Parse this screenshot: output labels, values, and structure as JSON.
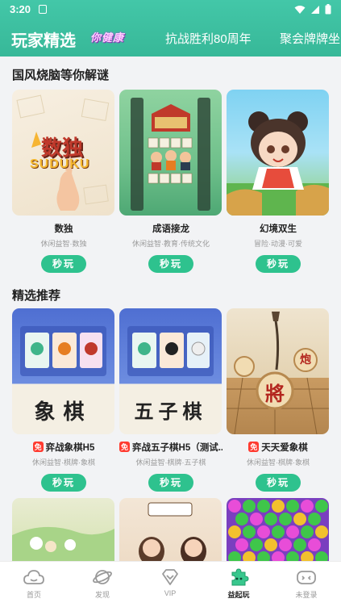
{
  "status": {
    "time": "3:20"
  },
  "header": {
    "title": "玩家精选",
    "badge": "你健康",
    "tabs": [
      {
        "label": "抗战胜利80周年"
      },
      {
        "label": "聚会牌牌坐"
      }
    ]
  },
  "sections": [
    {
      "title": "国风烧脑等你解谜",
      "games": [
        {
          "name": "数独",
          "free": false,
          "tags": "休闲益智·数独",
          "button": "秒玩",
          "art_text": "数独",
          "art_sub": "SUDUKU"
        },
        {
          "name": "成语接龙",
          "free": false,
          "tags": "休闲益智·教育·传统文化",
          "button": "秒玩"
        },
        {
          "name": "幻境双生",
          "free": false,
          "tags": "冒险·动漫·可爱",
          "button": "秒玩"
        }
      ]
    },
    {
      "title": "精选推荐",
      "games": [
        {
          "name": "弈战象棋H5",
          "free": true,
          "tags": "休闲益智·棋牌·象棋",
          "button": "秒玩",
          "art_text": "象棋"
        },
        {
          "name": "弈战五子棋H5（测试...",
          "free": true,
          "tags": "休闲益智·棋牌·五子棋",
          "button": "秒玩",
          "art_text": "五子棋"
        },
        {
          "name": "天天爱象棋",
          "free": true,
          "tags": "休闲益智·棋牌·象棋",
          "button": "秒玩",
          "art_text": "將",
          "art_sub": "炮"
        }
      ]
    }
  ],
  "free_label": "免",
  "tabbar": [
    {
      "label": "首页",
      "icon": "home-cloud-icon"
    },
    {
      "label": "发现",
      "icon": "planet-icon"
    },
    {
      "label": "VIP",
      "icon": "diamond-icon"
    },
    {
      "label": "益起玩",
      "icon": "puzzle-icon",
      "active": true
    },
    {
      "label": "未登录",
      "icon": "gamepad-icon"
    }
  ],
  "colors": {
    "header": "#3cbf9f",
    "play_button": "#2ec28e",
    "free_badge": "#ff3b30"
  }
}
